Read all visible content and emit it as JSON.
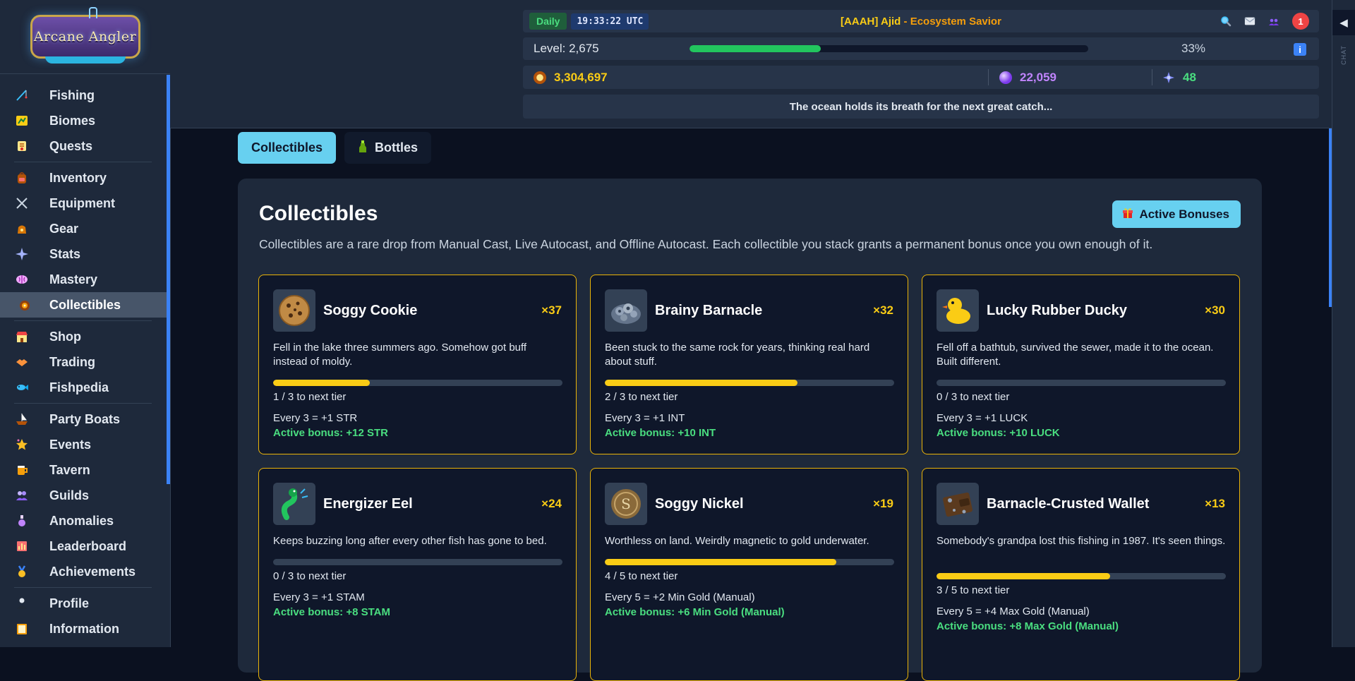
{
  "app": {
    "logo_text": "Arcane Angler"
  },
  "sidebar": {
    "groups": [
      [
        {
          "label": "Fishing",
          "icon": "fishing-rod-icon",
          "color": "#38bdf8"
        },
        {
          "label": "Biomes",
          "icon": "map-icon",
          "color": "#84cc16"
        },
        {
          "label": "Quests",
          "icon": "scroll-icon",
          "color": "#f97316"
        }
      ],
      [
        {
          "label": "Inventory",
          "icon": "backpack-icon",
          "color": "#f87171"
        },
        {
          "label": "Equipment",
          "icon": "crossed-swords-icon",
          "color": "#94a3b8"
        },
        {
          "label": "Gear",
          "icon": "bag-icon",
          "color": "#f59e0b"
        },
        {
          "label": "Stats",
          "icon": "sparkle-icon",
          "color": "#818cf8"
        },
        {
          "label": "Mastery",
          "icon": "brain-icon",
          "color": "#a78bfa"
        },
        {
          "label": "Collectibles",
          "icon": "treasure-icon",
          "color": "#f59e0b",
          "active": true
        }
      ],
      [
        {
          "label": "Shop",
          "icon": "shop-icon",
          "color": "#ef4444"
        },
        {
          "label": "Trading",
          "icon": "handshake-icon",
          "color": "#fb923c"
        },
        {
          "label": "Fishpedia",
          "icon": "fish-book-icon",
          "color": "#38bdf8"
        }
      ],
      [
        {
          "label": "Party Boats",
          "icon": "boat-icon",
          "color": "#f59e0b"
        },
        {
          "label": "Events",
          "icon": "star-icon",
          "color": "#fbbf24"
        },
        {
          "label": "Tavern",
          "icon": "mug-icon",
          "color": "#f97316"
        },
        {
          "label": "Guilds",
          "icon": "guild-icon",
          "color": "#a78bfa"
        },
        {
          "label": "Anomalies",
          "icon": "potion-icon",
          "color": "#c084fc"
        },
        {
          "label": "Leaderboard",
          "icon": "trophy-board-icon",
          "color": "#f87171"
        },
        {
          "label": "Achievements",
          "icon": "medal-icon",
          "color": "#fbbf24"
        }
      ],
      [
        {
          "label": "Profile",
          "icon": "person-icon",
          "color": "#94a3b8"
        },
        {
          "label": "Information",
          "icon": "info-book-icon",
          "color": "#f59e0b"
        }
      ]
    ]
  },
  "header": {
    "daily_label": "Daily",
    "clock": "19:33:22 UTC",
    "guild_tag": "[AAAH]",
    "player_name": "Ajid",
    "player_title": "Ecosystem Savior",
    "notification_count": "1",
    "level_label": "Level: 2,675",
    "xp_fraction": 0.33,
    "xp_percent": "33%",
    "currencies": [
      {
        "value": "3,304,697",
        "icon": "gold-coin-icon",
        "color": "#facc15"
      },
      {
        "value": "22,059",
        "icon": "purple-orb-icon",
        "color": "#c084fc"
      },
      {
        "value": "48",
        "icon": "gem-spark-icon",
        "color": "#4ade80"
      }
    ],
    "flavor_text": "The ocean holds its breath for the next great catch..."
  },
  "chat": {
    "label": "CHAT",
    "toggle_glyph": "◀"
  },
  "tabs": [
    {
      "label": "Collectibles",
      "active": true
    },
    {
      "label": "Bottles",
      "icon": "bottle-icon",
      "active": false
    }
  ],
  "panel": {
    "title": "Collectibles",
    "active_bonuses_label": "Active Bonuses",
    "description": "Collectibles are a rare drop from Manual Cast, Live Autocast, and Offline Autocast. Each collectible you stack grants a permanent bonus once you own enough of it."
  },
  "collectibles": [
    {
      "name": "Soggy Cookie",
      "count": "×37",
      "icon": "cookie-icon",
      "desc": "Fell in the lake three summers ago. Somehow got buff instead of moldy.",
      "progress": 0.333,
      "tier_text": "1 / 3 to next tier",
      "every_text": "Every 3 = +1 STR",
      "active_label": "Active bonus:",
      "active_value": "+12 STR"
    },
    {
      "name": "Brainy Barnacle",
      "count": "×32",
      "icon": "barnacle-icon",
      "desc": "Been stuck to the same rock for years, thinking real hard about stuff.",
      "progress": 0.667,
      "tier_text": "2 / 3 to next tier",
      "every_text": "Every 3 = +1 INT",
      "active_label": "Active bonus:",
      "active_value": "+10 INT"
    },
    {
      "name": "Lucky Rubber Ducky",
      "count": "×30",
      "icon": "rubber-duck-icon",
      "desc": "Fell off a bathtub, survived the sewer, made it to the ocean. Built different.",
      "progress": 0,
      "tier_text": "0 / 3 to next tier",
      "every_text": "Every 3 = +1 LUCK",
      "active_label": "Active bonus:",
      "active_value": "+10 LUCK"
    },
    {
      "name": "Energizer Eel",
      "count": "×24",
      "icon": "eel-icon",
      "desc": "Keeps buzzing long after every other fish has gone to bed.",
      "progress": 0,
      "tier_text": "0 / 3 to next tier",
      "every_text": "Every 3 = +1 STAM",
      "active_label": "Active bonus:",
      "active_value": "+8 STAM"
    },
    {
      "name": "Soggy Nickel",
      "count": "×19",
      "icon": "coin-icon",
      "desc": "Worthless on land. Weirdly magnetic to gold underwater.",
      "progress": 0.8,
      "tier_text": "4 / 5 to next tier",
      "every_text": "Every 5 = +2 Min Gold (Manual)",
      "active_label": "Active bonus:",
      "active_value": "+6 Min Gold (Manual)"
    },
    {
      "name": "Barnacle-Crusted Wallet",
      "count": "×13",
      "icon": "wallet-icon",
      "desc": "Somebody's grandpa lost this fishing in 1987. It's seen things.",
      "progress": 0.6,
      "tier_text": "3 / 5 to next tier",
      "every_text": "Every 5 = +4 Max Gold (Manual)",
      "active_label": "Active bonus:",
      "active_value": "+8 Max Gold (Manual)"
    }
  ]
}
